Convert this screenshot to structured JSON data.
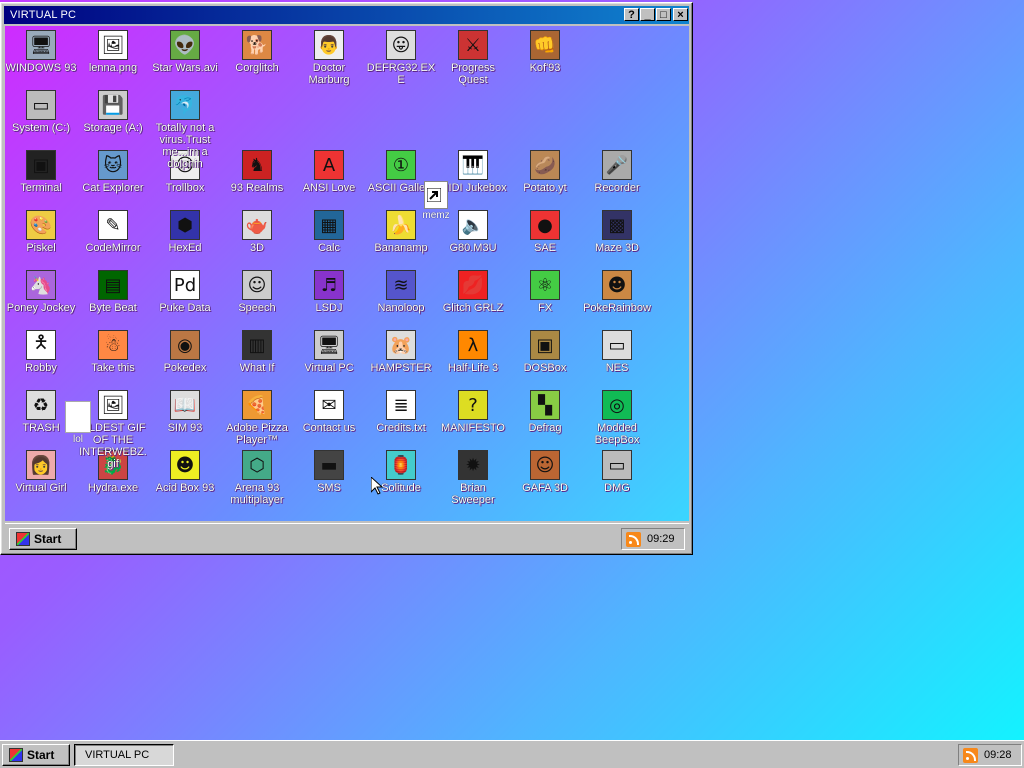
{
  "window": {
    "title": "VIRTUAL PC",
    "help": "?",
    "minimize": "_",
    "maximize": "□",
    "close": "×"
  },
  "inner_taskbar": {
    "start_label": "Start",
    "clock": "09:29"
  },
  "taskbar": {
    "start_label": "Start",
    "task_label": "VIRTUAL PC",
    "clock": "09:28"
  },
  "icons": [
    {
      "label": "WINDOWS 93",
      "icon": "computer-icon",
      "col": 0,
      "row": 0
    },
    {
      "label": "lenna.png",
      "icon": "image-file-icon",
      "col": 1,
      "row": 0
    },
    {
      "label": "Star Wars.avi",
      "icon": "yoda-icon",
      "col": 2,
      "row": 0
    },
    {
      "label": "Corglitch",
      "icon": "corgi-icon",
      "col": 3,
      "row": 0
    },
    {
      "label": "Doctor Marburg",
      "icon": "doctor-icon",
      "col": 4,
      "row": 0
    },
    {
      "label": "DEFRG32.EXE",
      "icon": "monitor-face-icon",
      "col": 5,
      "row": 0
    },
    {
      "label": "Progress Quest",
      "icon": "crossed-swords-icon",
      "col": 6,
      "row": 0
    },
    {
      "label": "Kof'93",
      "icon": "fighter-icon",
      "col": 7,
      "row": 0
    },
    {
      "label": "System (C:)",
      "icon": "drive-icon",
      "col": 0,
      "row": 1
    },
    {
      "label": "Storage (A:)",
      "icon": "floppy-drive-icon",
      "col": 1,
      "row": 1
    },
    {
      "label": "Totally not a virus.Trust me...im a dolphin",
      "icon": "dolphin-icon",
      "col": 2,
      "row": 1
    },
    {
      "label": "Terminal",
      "icon": "terminal-icon",
      "col": 0,
      "row": 2
    },
    {
      "label": "Cat Explorer",
      "icon": "cat-globe-icon",
      "col": 1,
      "row": 2
    },
    {
      "label": "Trollbox",
      "icon": "troll-icon",
      "col": 2,
      "row": 2
    },
    {
      "label": "93 Realms",
      "icon": "red-knight-icon",
      "col": 3,
      "row": 2
    },
    {
      "label": "ANSI Love",
      "icon": "ansi-icon",
      "col": 4,
      "row": 2
    },
    {
      "label": "ASCII Gallery",
      "icon": "abc-icon",
      "col": 5,
      "row": 2
    },
    {
      "label": "MIDI Jukebox",
      "icon": "piano-icon",
      "col": 6,
      "row": 2
    },
    {
      "label": "Potato.yt",
      "icon": "potato-icon",
      "col": 7,
      "row": 2
    },
    {
      "label": "Recorder",
      "icon": "microphone-icon",
      "col": 8,
      "row": 2
    },
    {
      "label": "Piskel",
      "icon": "palette-icon",
      "col": 0,
      "row": 3
    },
    {
      "label": "CodeMirror",
      "icon": "codemirror-icon",
      "col": 1,
      "row": 3
    },
    {
      "label": "HexEd",
      "icon": "cube-icon",
      "col": 2,
      "row": 3
    },
    {
      "label": "3D",
      "icon": "teapot-icon",
      "col": 3,
      "row": 3
    },
    {
      "label": "Calc",
      "icon": "calculator-icon",
      "col": 4,
      "row": 3
    },
    {
      "label": "Bananamp",
      "icon": "banana-icon",
      "col": 5,
      "row": 3
    },
    {
      "label": "G80.M3U",
      "icon": "speaker-file-icon",
      "col": 6,
      "row": 3
    },
    {
      "label": "SAE",
      "icon": "amiga-ball-icon",
      "col": 7,
      "row": 3
    },
    {
      "label": "Maze 3D",
      "icon": "maze-icon",
      "col": 8,
      "row": 3
    },
    {
      "label": "Poney Jockey",
      "icon": "pony-icon",
      "col": 0,
      "row": 4
    },
    {
      "label": "Byte Beat",
      "icon": "bytebeat-icon",
      "col": 1,
      "row": 4
    },
    {
      "label": "Puke Data",
      "icon": "pd-icon",
      "col": 2,
      "row": 4
    },
    {
      "label": "Speech",
      "icon": "face-icon",
      "col": 3,
      "row": 4
    },
    {
      "label": "LSDJ",
      "icon": "lsdj-icon",
      "col": 4,
      "row": 4
    },
    {
      "label": "Nanoloop",
      "icon": "nanoloop-icon",
      "col": 5,
      "row": 4
    },
    {
      "label": "Glitch GRLZ",
      "icon": "lips-icon",
      "col": 6,
      "row": 4
    },
    {
      "label": "FX",
      "icon": "atom-icon",
      "col": 7,
      "row": 4
    },
    {
      "label": "PokeRainbow",
      "icon": "pokerainbow-icon",
      "col": 8,
      "row": 4
    },
    {
      "label": "Robby",
      "icon": "stick-figure-icon",
      "col": 0,
      "row": 5
    },
    {
      "label": "Take this",
      "icon": "pixel-man-icon",
      "col": 1,
      "row": 5
    },
    {
      "label": "Pokedex",
      "icon": "pokedex-icon",
      "col": 2,
      "row": 5
    },
    {
      "label": "What If",
      "icon": "whatif-icon",
      "col": 3,
      "row": 5
    },
    {
      "label": "Virtual PC",
      "icon": "virtual-pc-icon",
      "col": 4,
      "row": 5
    },
    {
      "label": "HAMPSTER",
      "icon": "hamster-icon",
      "col": 5,
      "row": 5
    },
    {
      "label": "Half-Life 3",
      "icon": "lambda-icon",
      "col": 6,
      "row": 5
    },
    {
      "label": "DOSBox",
      "icon": "dosbox-icon",
      "col": 7,
      "row": 5
    },
    {
      "label": "NES",
      "icon": "nes-icon",
      "col": 8,
      "row": 5
    },
    {
      "label": "TRASH",
      "icon": "recycle-bin-icon",
      "col": 0,
      "row": 6
    },
    {
      "label": "OLDEST GIF OF THE INTERWEBZ.gif",
      "icon": "gif-file-icon",
      "col": 1,
      "row": 6
    },
    {
      "label": "SIM 93",
      "icon": "book-icon",
      "col": 2,
      "row": 6
    },
    {
      "label": "Adobe Pizza Player™",
      "icon": "pizza-icon",
      "col": 3,
      "row": 6
    },
    {
      "label": "Contact us",
      "icon": "mail-icon",
      "col": 4,
      "row": 6
    },
    {
      "label": "Credits.txt",
      "icon": "text-file-icon",
      "col": 5,
      "row": 6
    },
    {
      "label": "MANIFESTO",
      "icon": "question-icon",
      "col": 6,
      "row": 6
    },
    {
      "label": "Defrag",
      "icon": "defrag-icon",
      "col": 7,
      "row": 6
    },
    {
      "label": "Modded BeepBox",
      "icon": "beepbox-icon",
      "col": 8,
      "row": 6
    },
    {
      "label": "Virtual Girl",
      "icon": "girl-icon",
      "col": 0,
      "row": 7
    },
    {
      "label": "Hydra.exe",
      "icon": "hydra-icon",
      "col": 1,
      "row": 7
    },
    {
      "label": "Acid Box 93",
      "icon": "smiley-icon",
      "col": 2,
      "row": 7
    },
    {
      "label": "Arena 93 multiplayer",
      "icon": "rgb-cube-icon",
      "col": 3,
      "row": 7
    },
    {
      "label": "SMS",
      "icon": "console-icon",
      "col": 4,
      "row": 7
    },
    {
      "label": "Solitude",
      "icon": "lantern-icon",
      "col": 5,
      "row": 7
    },
    {
      "label": "Brian Sweeper",
      "icon": "mine-icon",
      "col": 6,
      "row": 7
    },
    {
      "label": "GAFA 3D",
      "icon": "soldier-icon",
      "col": 7,
      "row": 7
    },
    {
      "label": "DMG",
      "icon": "gameboy-icon",
      "col": 8,
      "row": 7
    }
  ],
  "floating": {
    "memz": "memz",
    "lol": "lol"
  }
}
